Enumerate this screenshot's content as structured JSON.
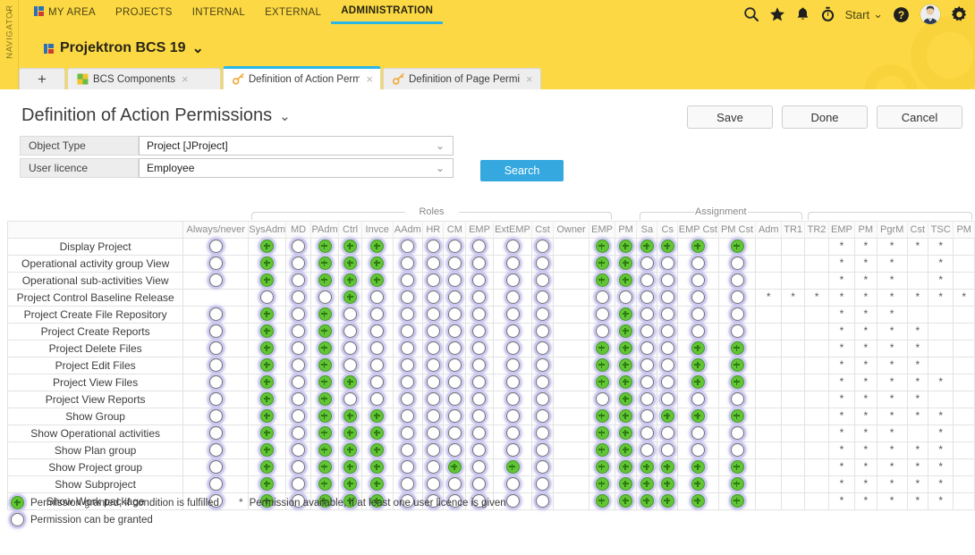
{
  "navigator": {
    "label": "NAVIGATOR",
    "chevron": "⌄"
  },
  "topnav": {
    "items": [
      {
        "label": "MY AREA",
        "icon": "app-squares-icon",
        "active": false
      },
      {
        "label": "PROJECTS",
        "icon": "",
        "active": false
      },
      {
        "label": "INTERNAL",
        "icon": "",
        "active": false
      },
      {
        "label": "EXTERNAL",
        "icon": "",
        "active": false
      },
      {
        "label": "ADMINISTRATION",
        "icon": "",
        "active": true
      }
    ],
    "right_icons": [
      "search-icon",
      "star-icon",
      "bell-icon",
      "stopwatch-icon"
    ],
    "start_label": "Start",
    "start_chevron": "⌄",
    "help_icon": "help-icon",
    "avatar_icon": "avatar",
    "settings_icon": "gear-icon"
  },
  "project": {
    "title": "Projektron BCS 19",
    "chevron": "⌄",
    "icon": "app-squares-icon"
  },
  "tabs": {
    "add_label": "+",
    "items": [
      {
        "label": "BCS Components",
        "icon": "puzzle-icon",
        "active": false,
        "close": "×"
      },
      {
        "label": "Definition of Action Perm",
        "icon": "key-icon",
        "active": true,
        "close": "×"
      },
      {
        "label": "Definition of Page Permi",
        "icon": "key-icon",
        "active": false,
        "close": "×"
      }
    ]
  },
  "page": {
    "title": "Definition of Action Permissions",
    "title_chevron": "⌄",
    "buttons": [
      {
        "label": "Save",
        "name": "save-button"
      },
      {
        "label": "Done",
        "name": "done-button"
      },
      {
        "label": "Cancel",
        "name": "cancel-button"
      }
    ]
  },
  "filters": {
    "rows": [
      {
        "label": "Object Type",
        "value": "Project [JProject]",
        "name": "object-type"
      },
      {
        "label": "User licence",
        "value": "Employee",
        "name": "user-licence"
      }
    ],
    "search_label": "Search"
  },
  "grid": {
    "row_header": "",
    "groups": [
      {
        "label": "",
        "span": 1
      },
      {
        "label": "Roles",
        "span": 13
      },
      {
        "label": "",
        "span": 1
      },
      {
        "label": "Assignment",
        "span": 6
      },
      {
        "label": "",
        "span": 9
      }
    ],
    "columns": [
      "Always/never",
      "SysAdm",
      "MD",
      "PAdm",
      "Ctrl",
      "Invce",
      "AAdm",
      "HR",
      "CM",
      "EMP",
      "ExtEMP",
      "Cst",
      "Owner",
      "EMP",
      "PM",
      "Sa",
      "Cs",
      "EMP Cst",
      "PM Cst",
      "Adm",
      "TR1",
      "TR2",
      "EMP",
      "PM",
      "PgrM",
      "Cst",
      "TSC",
      "PM"
    ],
    "rows": [
      {
        "label": "Display Project",
        "cells": [
          "o",
          "+",
          "o",
          "+",
          "+",
          "+",
          "o",
          "o",
          "o",
          "o",
          "o",
          "o",
          "",
          "+",
          "+",
          "+",
          "+",
          "+",
          "+",
          "",
          "",
          "",
          "*",
          "*",
          "*",
          "*",
          "*",
          ""
        ]
      },
      {
        "label": "Operational activity group View",
        "cells": [
          "o",
          "+",
          "o",
          "+",
          "+",
          "+",
          "o",
          "o",
          "o",
          "o",
          "o",
          "o",
          "",
          "+",
          "+",
          "o",
          "o",
          "o",
          "o",
          "",
          "",
          "",
          "*",
          "*",
          "*",
          "",
          "*",
          ""
        ]
      },
      {
        "label": "Operational sub-activities View",
        "cells": [
          "o",
          "+",
          "o",
          "+",
          "+",
          "+",
          "o",
          "o",
          "o",
          "o",
          "o",
          "o",
          "",
          "+",
          "+",
          "o",
          "o",
          "o",
          "o",
          "",
          "",
          "",
          "*",
          "*",
          "*",
          "",
          "*",
          ""
        ]
      },
      {
        "label": "Project Control Baseline Release",
        "cells": [
          "",
          "o",
          "o",
          "o",
          "+",
          "o",
          "o",
          "o",
          "o",
          "o",
          "o",
          "o",
          "",
          "o",
          "o",
          "o",
          "o",
          "o",
          "o",
          "*",
          "*",
          "*",
          "*",
          "*",
          "*",
          "*",
          "*",
          "*"
        ]
      },
      {
        "label": "Project Create File Repository",
        "cells": [
          "o",
          "+",
          "o",
          "+",
          "o",
          "o",
          "o",
          "o",
          "o",
          "o",
          "o",
          "o",
          "",
          "o",
          "+",
          "o",
          "o",
          "o",
          "o",
          "",
          "",
          "",
          "*",
          "*",
          "*",
          "",
          "",
          " "
        ]
      },
      {
        "label": "Project Create Reports",
        "cells": [
          "o",
          "+",
          "o",
          "+",
          "o",
          "o",
          "o",
          "o",
          "o",
          "o",
          "o",
          "o",
          "",
          "o",
          "+",
          "o",
          "o",
          "o",
          "o",
          "",
          "",
          "",
          "*",
          "*",
          "*",
          "*",
          "",
          " "
        ]
      },
      {
        "label": "Project Delete Files",
        "cells": [
          "o",
          "+",
          "o",
          "+",
          "o",
          "o",
          "o",
          "o",
          "o",
          "o",
          "o",
          "o",
          "",
          "+",
          "+",
          "o",
          "o",
          "+",
          "+",
          "",
          "",
          "",
          "*",
          "*",
          "*",
          "*",
          "",
          " "
        ]
      },
      {
        "label": "Project Edit Files",
        "cells": [
          "o",
          "+",
          "o",
          "+",
          "o",
          "o",
          "o",
          "o",
          "o",
          "o",
          "o",
          "o",
          "",
          "+",
          "+",
          "o",
          "o",
          "+",
          "+",
          "",
          "",
          "",
          "*",
          "*",
          "*",
          "*",
          "",
          " "
        ]
      },
      {
        "label": "Project View Files",
        "cells": [
          "o",
          "+",
          "o",
          "+",
          "+",
          "o",
          "o",
          "o",
          "o",
          "o",
          "o",
          "o",
          "",
          "+",
          "+",
          "o",
          "o",
          "+",
          "+",
          "",
          "",
          "",
          "*",
          "*",
          "*",
          "*",
          "*",
          " "
        ]
      },
      {
        "label": "Project View Reports",
        "cells": [
          "o",
          "+",
          "o",
          "+",
          "o",
          "o",
          "o",
          "o",
          "o",
          "o",
          "o",
          "o",
          "",
          "o",
          "+",
          "o",
          "o",
          "o",
          "o",
          "",
          "",
          "",
          "*",
          "*",
          "*",
          "*",
          "",
          " "
        ]
      },
      {
        "label": "Show Group",
        "cells": [
          "o",
          "+",
          "o",
          "+",
          "+",
          "+",
          "o",
          "o",
          "o",
          "o",
          "o",
          "o",
          "",
          "+",
          "+",
          "o",
          "+",
          "+",
          "+",
          "",
          "",
          "",
          "*",
          "*",
          "*",
          "*",
          "*",
          " "
        ]
      },
      {
        "label": "Show Operational activities",
        "cells": [
          "o",
          "+",
          "o",
          "+",
          "+",
          "+",
          "o",
          "o",
          "o",
          "o",
          "o",
          "o",
          "",
          "+",
          "+",
          "o",
          "o",
          "o",
          "o",
          "",
          "",
          "",
          "*",
          "*",
          "*",
          "",
          "*",
          " "
        ]
      },
      {
        "label": "Show Plan group",
        "cells": [
          "o",
          "+",
          "o",
          "+",
          "+",
          "+",
          "o",
          "o",
          "o",
          "o",
          "o",
          "o",
          "",
          "+",
          "+",
          "o",
          "o",
          "o",
          "o",
          "",
          "",
          "",
          "*",
          "*",
          "*",
          "*",
          "*",
          " "
        ]
      },
      {
        "label": "Show Project group",
        "cells": [
          "o",
          "+",
          "o",
          "+",
          "+",
          "+",
          "o",
          "o",
          "+",
          "o",
          "+",
          "o",
          "",
          "+",
          "+",
          "+",
          "+",
          "+",
          "+",
          "",
          "",
          "",
          "*",
          "*",
          "*",
          "*",
          "*",
          " "
        ]
      },
      {
        "label": "Show Subproject",
        "cells": [
          "o",
          "+",
          "o",
          "+",
          "+",
          "+",
          "o",
          "o",
          "o",
          "o",
          "o",
          "o",
          "",
          "+",
          "+",
          "+",
          "+",
          "+",
          "+",
          "",
          "",
          "",
          "*",
          "*",
          "*",
          "*",
          "*",
          " "
        ]
      },
      {
        "label": "Show Work package",
        "cells": [
          "o",
          "+",
          "o",
          "+",
          "+",
          "+",
          "o",
          "o",
          "o",
          "o",
          "o",
          "o",
          "",
          "+",
          "+",
          "+",
          "+",
          "+",
          "+",
          "",
          "",
          "",
          "*",
          "*",
          "*",
          "*",
          "*",
          " "
        ]
      }
    ]
  },
  "legend": {
    "line1_icon": "plus-icon",
    "line1": "Permission granted, if condition is fulfilled",
    "line1b_icon": "*",
    "line1b": "Permission available, if at least one user licence is given",
    "line2_icon": "circle-icon",
    "line2": "Permission can be granted"
  },
  "colors": {
    "brand_yellow": "#fcd944",
    "accent_blue": "#29b6e8",
    "search_blue": "#35a8e0",
    "granted_green": "#63c437",
    "halo_purple": "#cdcaf0"
  }
}
